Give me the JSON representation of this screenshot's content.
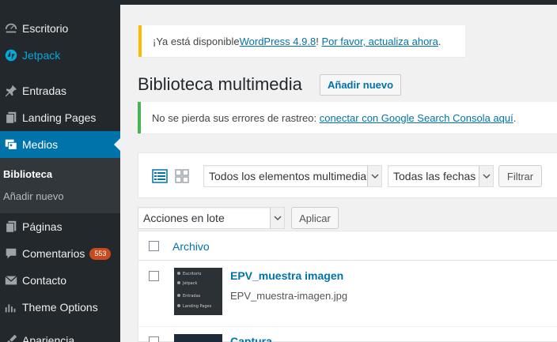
{
  "sidebar": {
    "items": [
      {
        "label": "Escritorio",
        "icon": "dashboard-icon"
      },
      {
        "label": "Jetpack",
        "icon": "jetpack-icon"
      },
      {
        "label": "Entradas",
        "icon": "pin-icon"
      },
      {
        "label": "Landing Pages",
        "icon": "pages-icon"
      },
      {
        "label": "Medios",
        "icon": "media-icon"
      },
      {
        "label": "Páginas",
        "icon": "page-icon"
      },
      {
        "label": "Comentarios",
        "icon": "comment-icon",
        "badge": "553"
      },
      {
        "label": "Contacto",
        "icon": "mail-icon"
      },
      {
        "label": "Theme Options",
        "icon": "chart-icon"
      },
      {
        "label": "Apariencia",
        "icon": "brush-icon"
      }
    ],
    "submenu": [
      {
        "label": "Biblioteca"
      },
      {
        "label": "Añadir nuevo"
      }
    ]
  },
  "update_notice": {
    "prefix": "¡Ya está disponible ",
    "link1": "WordPress 4.9.8",
    "middle": "! ",
    "link2": "Por favor, actualiza ahora",
    "suffix": "."
  },
  "page": {
    "title": "Biblioteca multimedia",
    "add_new": "Añadir nuevo"
  },
  "info_notice": {
    "prefix": "No se pierda sus errores de rastreo: ",
    "link": "conectar con Google Search Consola aquí",
    "suffix": "."
  },
  "filters": {
    "media_type": "Todos los elementos multimedia",
    "dates": "Todas las fechas",
    "filter_button": "Filtrar"
  },
  "bulk": {
    "select": "Acciones en lote",
    "apply": "Aplicar"
  },
  "table": {
    "column_title": "Archivo",
    "rows": [
      {
        "title": "EPV_muestra imagen",
        "filename": "EPV_muestra-imagen.jpg",
        "thumb_lines": [
          "Escritorio",
          "Jetpack",
          "Entradas",
          "Landing Pages"
        ]
      },
      {
        "title": "Captura",
        "filename": ""
      }
    ]
  },
  "colors": {
    "sidebar_bg": "#23282d",
    "accent": "#0073aa",
    "update_border": "#ffb900",
    "info_border": "#46b450",
    "badge": "#ca4a1f"
  }
}
